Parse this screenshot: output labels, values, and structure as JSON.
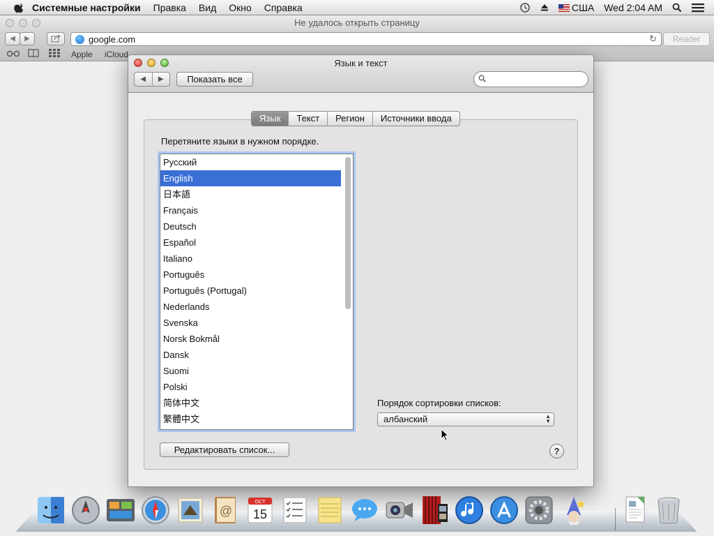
{
  "menubar": {
    "app_name": "Системные настройки",
    "items": [
      "Правка",
      "Вид",
      "Окно",
      "Справка"
    ],
    "input_source": "США",
    "clock": "Wed 2:04 AM"
  },
  "safari": {
    "title": "Не удалось открыть страницу",
    "url": "google.com",
    "reader_label": "Reader",
    "bookmarks": [
      "Apple",
      "iCloud"
    ]
  },
  "prefs": {
    "title": "Язык и текст",
    "show_all": "Показать все",
    "search": {
      "value": "",
      "placeholder": ""
    },
    "tabs": [
      {
        "label": "Язык",
        "active": true
      },
      {
        "label": "Текст",
        "active": false
      },
      {
        "label": "Регион",
        "active": false
      },
      {
        "label": "Источники ввода",
        "active": false
      }
    ],
    "drag_label": "Перетяните языки в нужном порядке.",
    "languages": [
      {
        "label": "Русский",
        "selected": false
      },
      {
        "label": "English",
        "selected": true
      },
      {
        "label": "日本語",
        "selected": false
      },
      {
        "label": "Français",
        "selected": false
      },
      {
        "label": "Deutsch",
        "selected": false
      },
      {
        "label": "Español",
        "selected": false
      },
      {
        "label": "Italiano",
        "selected": false
      },
      {
        "label": "Português",
        "selected": false
      },
      {
        "label": "Português (Portugal)",
        "selected": false
      },
      {
        "label": "Nederlands",
        "selected": false
      },
      {
        "label": "Svenska",
        "selected": false
      },
      {
        "label": "Norsk Bokmål",
        "selected": false
      },
      {
        "label": "Dansk",
        "selected": false
      },
      {
        "label": "Suomi",
        "selected": false
      },
      {
        "label": "Polski",
        "selected": false
      },
      {
        "label": "简体中文",
        "selected": false
      },
      {
        "label": "繁體中文",
        "selected": false
      }
    ],
    "sort_label": "Порядок сортировки списков:",
    "sort_value": "албанский",
    "edit_list": "Редактировать список...",
    "help": "?"
  },
  "dock": {
    "calendar_month": "OCT",
    "calendar_day": "15",
    "icons": [
      "finder-icon",
      "launchpad-icon",
      "mission-control-icon",
      "safari-icon",
      "mail-icon",
      "contacts-icon",
      "calendar-icon",
      "reminders-icon",
      "notes-icon",
      "messages-icon",
      "facetime-icon",
      "photo-booth-icon",
      "itunes-icon",
      "app-store-icon",
      "system-preferences-icon",
      "wizard-icon",
      "preview-document-icon",
      "trash-icon"
    ]
  },
  "colors": {
    "selection": "#3a6fd6",
    "focus_ring": "#a9c8ee",
    "close": "#d8322a",
    "minimize": "#d9a01b",
    "zoom": "#4fa52f"
  }
}
